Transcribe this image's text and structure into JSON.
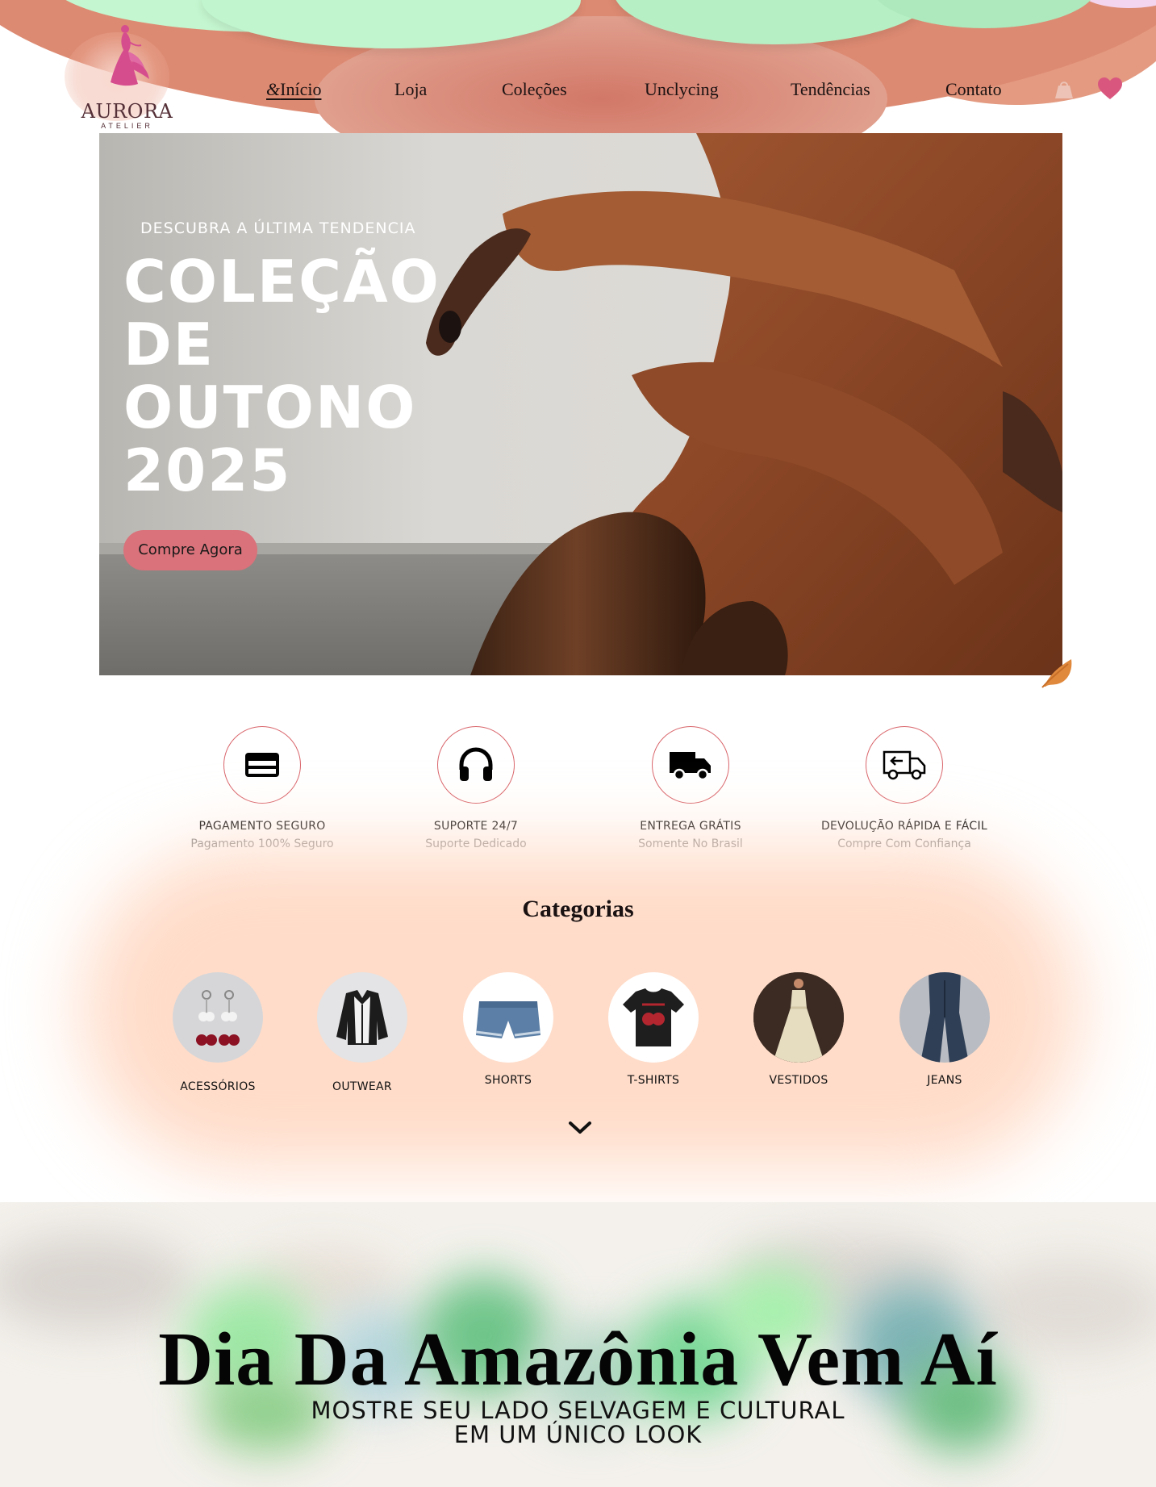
{
  "brand": {
    "name": "AURORA",
    "tagline": "ATELIER"
  },
  "nav": {
    "items": [
      {
        "label": "Início",
        "active": true
      },
      {
        "label": "Loja"
      },
      {
        "label": "Coleções"
      },
      {
        "label": "Unclycing"
      },
      {
        "label": "Tendências"
      },
      {
        "label": "Contato"
      }
    ],
    "icons": [
      "shopping-bag-icon",
      "heart-icon"
    ]
  },
  "hero": {
    "subtitle": "DESCUBRA A ÚLTIMA TENDENCIA",
    "title_lines": [
      "COLEÇÃO",
      "DE",
      "OUTONO",
      "2025"
    ],
    "cta": "Compre Agora",
    "cta_color": "#d9727a"
  },
  "features": [
    {
      "icon": "credit-card-icon",
      "title": "PAGAMENTO SEGURO",
      "desc": "Pagamento 100% Seguro"
    },
    {
      "icon": "headphones-icon",
      "title": "SUPORTE 24/7",
      "desc": "Suporte Dedicado"
    },
    {
      "icon": "truck-icon",
      "title": "ENTREGA GRÁTIS",
      "desc": "Somente No Brasil"
    },
    {
      "icon": "return-truck-icon",
      "title": "DEVOLUÇÃO RÁPIDA E FÁCIL",
      "desc": "Compre Com Confiança"
    }
  ],
  "categories": {
    "title": "Categorias",
    "items": [
      {
        "label": "ACESSÓRIOS"
      },
      {
        "label": "OUTWEAR"
      },
      {
        "label": "SHORTS"
      },
      {
        "label": "T-SHIRTS"
      },
      {
        "label": "VESTIDOS"
      },
      {
        "label": "JEANS"
      }
    ]
  },
  "promo": {
    "title": "Dia Da Amazônia Vem Aí",
    "subtitle_lines": [
      "MOSTRE SEU LADO SELVAGEM E CULTURAL",
      "EM UM ÚNICO LOOK"
    ]
  },
  "colors": {
    "header": "#dd8a72",
    "mint": "#c0f5cd",
    "accent": "#d9656b",
    "categories_bg": "#ffdcc9"
  }
}
